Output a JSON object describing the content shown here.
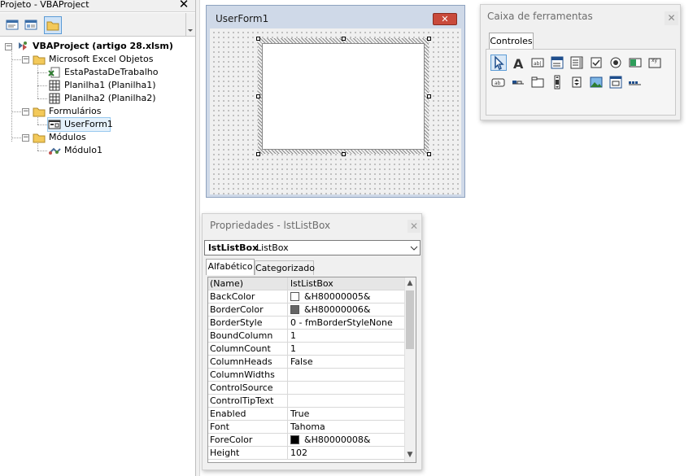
{
  "project": {
    "title": "Projeto - VBAProject",
    "close": "✕",
    "tree": {
      "root": "VBAProject (artigo 28.xlsm)",
      "excel_objects": "Microsoft Excel Objetos",
      "this_workbook": "EstaPastaDeTrabalho",
      "sheet1": "Planilha1 (Planilha1)",
      "sheet2": "Planilha2 (Planilha2)",
      "forms": "Formulários",
      "userform1": "UserForm1",
      "modules": "Módulos",
      "module1": "Módulo1"
    }
  },
  "userform": {
    "title": "UserForm1",
    "close": "✕"
  },
  "toolbox": {
    "title": "Caixa de ferramentas",
    "close": "✕",
    "tab": "Controles",
    "tools_row1": [
      "select-objects-icon",
      "label-icon",
      "textbox-icon",
      "combobox-icon",
      "listbox-icon",
      "checkbox-icon",
      "optionbutton-icon",
      "togglebutton-icon",
      "frame-icon"
    ],
    "tools_row2": [
      "commandbutton-icon",
      "tabstrip-icon",
      "multipage-icon",
      "scrollbar-icon",
      "spinbutton-icon",
      "image-icon",
      "refedit-icon",
      "extra-control-icon"
    ]
  },
  "properties": {
    "title": "Propriedades - lstListBox",
    "close": "✕",
    "object_name": "lstListBox",
    "object_type": "ListBox",
    "tab_alpha": "Alfabético",
    "tab_cat": "Categorizado",
    "rows": [
      {
        "name": "(Name)",
        "value": "lstListBox"
      },
      {
        "name": "BackColor",
        "value": "&H80000005&",
        "swatch": "#ffffff"
      },
      {
        "name": "BorderColor",
        "value": "&H80000006&",
        "swatch": "#646464"
      },
      {
        "name": "BorderStyle",
        "value": "0 - fmBorderStyleNone"
      },
      {
        "name": "BoundColumn",
        "value": "1"
      },
      {
        "name": "ColumnCount",
        "value": "1"
      },
      {
        "name": "ColumnHeads",
        "value": "False"
      },
      {
        "name": "ColumnWidths",
        "value": ""
      },
      {
        "name": "ControlSource",
        "value": ""
      },
      {
        "name": "ControlTipText",
        "value": ""
      },
      {
        "name": "Enabled",
        "value": "True"
      },
      {
        "name": "Font",
        "value": "Tahoma"
      },
      {
        "name": "ForeColor",
        "value": "&H80000008&",
        "swatch": "#000000"
      },
      {
        "name": "Height",
        "value": "102"
      }
    ]
  },
  "colors": {
    "accent": "#5b9bd5",
    "close_red": "#c94a3b"
  }
}
